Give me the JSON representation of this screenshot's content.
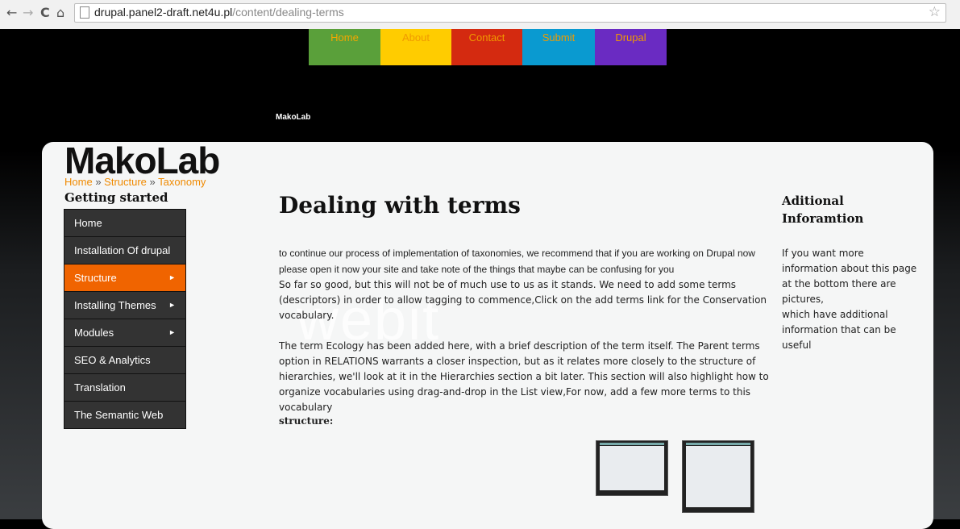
{
  "browser": {
    "url_host": "drupal.panel2-draft.net4u.pl",
    "url_path": "/content/dealing-terms"
  },
  "topnav": [
    "Home",
    "About",
    "Contact",
    "Submit",
    "Drupal"
  ],
  "site_small_label": "MakoLab",
  "logo": "MakoLab",
  "breadcrumb": [
    "Home",
    "Structure",
    "Taxonomy"
  ],
  "breadcrumb_sep": "»",
  "sidebar": {
    "title": "Getting started",
    "items": [
      {
        "label": "Home"
      },
      {
        "label": "Installation Of drupal"
      },
      {
        "label": "Structure",
        "arrow": "►"
      },
      {
        "label": "Installing Themes",
        "arrow": "►"
      },
      {
        "label": "Modules",
        "arrow": "►"
      },
      {
        "label": "SEO & Analytics"
      },
      {
        "label": "Translation"
      },
      {
        "label": "The Semantic Web"
      }
    ]
  },
  "content": {
    "title": "Dealing with terms",
    "watermark": "webit",
    "p1": "to continue our process of implementation of taxonomies, we recommend that if you are working on Drupal now please open it now  your site and take note of the things that maybe can be confusing for you",
    "p2": "So far so good, but this will not be of much use to us as it stands. We need to add some terms (descriptors) in order to allow tagging to commence,Click on the add terms link for the Conservation vocabulary.",
    "p3": "The term Ecology has been added here, with a brief description of the term itself. The Parent terms option in RELATIONS warrants a closer inspection, but as it relates more closely to the structure of hierarchies, we'll look at it in the Hierarchies section a bit later. This section will also highlight how to organize vocabularies using drag-and-drop in the List view,For now, add a few more terms to this vocabulary",
    "label": "structure:"
  },
  "aside": {
    "title": "Aditional Inforamtion",
    "lines": [
      "If you want more information about this page at the bottom there are pictures,",
      "which have additional information that can be useful"
    ]
  }
}
